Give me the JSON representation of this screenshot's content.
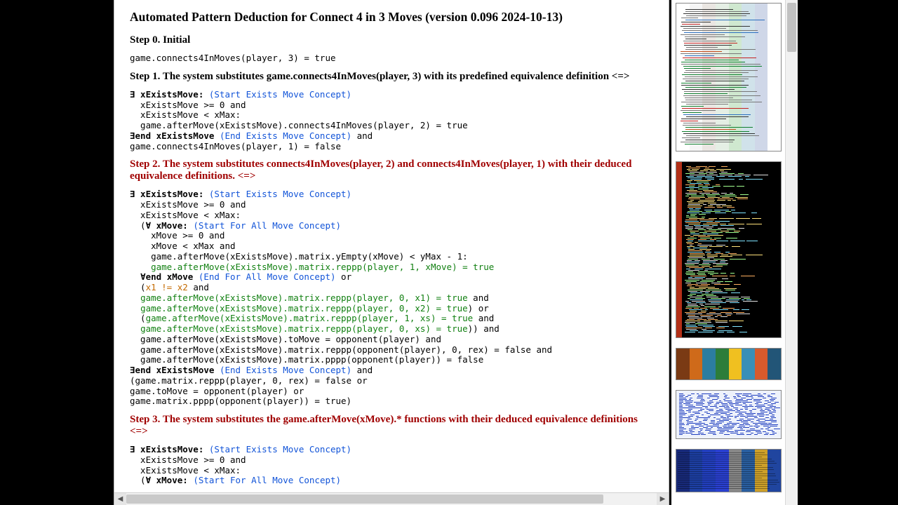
{
  "title": "Automated Pattern Deduction for Connect 4 in 3 Moves (version 0.096 2024-10-13)",
  "step0_heading": "Step 0. Initial",
  "step1_heading": "Step 1. The system substitutes game.connects4InMoves(player, 3) with its predefined equivalence definition <=>",
  "step2_heading": "Step 2. The system substitutes connects4InMoves(player, 2) and connects4InMoves(player, 1) with their deduced equivalence definitions. <=>",
  "step3_heading": "Step 3. The system substitutes the game.afterMove(xMove).* functions with their deduced equivalence definitions <=>",
  "code0": "game.connects4InMoves(player, 3) = true",
  "c1": {
    "l1a": "∃ xExistsMove:",
    "l1b": " (Start Exists Move Concept)",
    "l2": "  xExistsMove >= 0 and",
    "l3": "  xExistsMove < xMax:",
    "l4": "  game.afterMove(xExistsMove).connects4InMoves(player, 2) = true",
    "l5a": "∃end xExistsMove",
    "l5b": " (End Exists Move Concept)",
    "l5c": " and",
    "l6": "game.connects4InMoves(player, 1) = false"
  },
  "c2": {
    "l01a": "∃ xExistsMove:",
    "l01b": " (Start Exists Move Concept)",
    "l02": "  xExistsMove >= 0 and",
    "l03": "  xExistsMove < xMax:",
    "l04a": "  (",
    "l04b": "∀ xMove:",
    "l04c": " (Start For All Move Concept)",
    "l05": "    xMove >= 0 and",
    "l06": "    xMove < xMax and",
    "l07": "    game.afterMove(xExistsMove).matrix.yEmpty(xMove) < yMax - 1:",
    "l08": "    game.afterMove(xExistsMove).matrix.reppp(player, 1, xMove) = true",
    "l09a": "  ",
    "l09b": "∀end xMove",
    "l09c": " (End For All Move Concept)",
    "l09d": " or",
    "l10a": "  (",
    "l10b": "x1 != x2",
    "l10c": " and",
    "l11a": "  ",
    "l11b": "game.afterMove(xExistsMove).matrix.reppp(player, 0, x1) = true",
    "l11c": " and",
    "l12a": "  ",
    "l12b": "game.afterMove(xExistsMove).matrix.reppp(player, 0, x2) = true",
    "l12c": ") or",
    "l13a": "  (",
    "l13b": "game.afterMove(xExistsMove).matrix.reppp(player, 1, xs) = true",
    "l13c": " and",
    "l14a": "  ",
    "l14b": "game.afterMove(xExistsMove).matrix.reppp(player, 0, xs) = true",
    "l14c": ")) and",
    "l15": "  game.afterMove(xExistsMove).toMove = opponent(player) and",
    "l16": "  game.afterMove(xExistsMove).matrix.reppp(opponent(player), 0, rex) = false and",
    "l17": "  game.afterMove(xExistsMove).matrix.pppp(opponent(player)) = false",
    "l18a": "∃end xExistsMove",
    "l18b": " (End Exists Move Concept)",
    "l18c": " and",
    "l19": "(game.matrix.reppp(player, 0, rex) = false or",
    "l20": "game.toMove = opponent(player) or",
    "l21": "game.matrix.pppp(opponent(player)) = true)"
  },
  "c3": {
    "l1a": "∃ xExistsMove:",
    "l1b": " (Start Exists Move Concept)",
    "l2": "  xExistsMove >= 0 and",
    "l3": "  xExistsMove < xMax:",
    "l4a": "  (",
    "l4b": "∀ xMove:",
    "l4c": " (Start For All Move Concept)"
  },
  "nav_arrows": {
    "left": "◀",
    "right": "▶"
  },
  "thumbs": {
    "t1_bars": [
      "#fff",
      "#f5f5f5",
      "#eae6e2",
      "#e5efe5",
      "#cfe8cf",
      "#d0e2ea",
      "#cfd7e8",
      "#fff"
    ],
    "t1_hl": [
      "#2b6fbf",
      "#0e7f2e",
      "#c44c1b",
      "#c42020",
      "#333"
    ],
    "t3_strip": [
      "#7a3a14",
      "#cf6a1a",
      "#2c7da0",
      "#2c7d3a",
      "#f0c020",
      "#3a8fb7",
      "#d85a2c",
      "#225577"
    ],
    "t4_strip": [
      "#182a7a",
      "#1d3fa3",
      "#223fbe",
      "#2a40d0",
      "#888",
      "#2a5fa0",
      "#cda02a",
      "#20459f"
    ]
  }
}
